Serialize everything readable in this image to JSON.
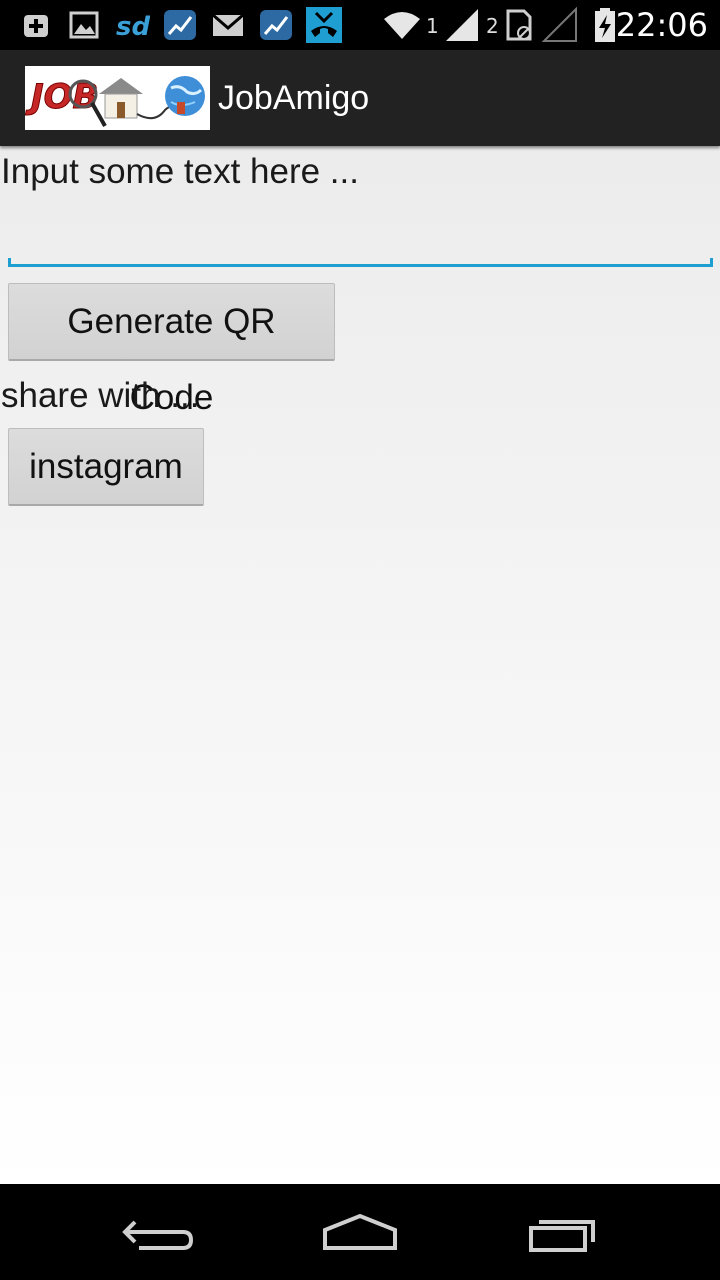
{
  "status_bar": {
    "time": "22:06",
    "sim1": "1",
    "sim2": "2",
    "icons": [
      "add-notification-icon",
      "gallery-icon",
      "sd-card-icon",
      "stocks-icon",
      "mail-icon",
      "stocks-icon",
      "missed-call-icon",
      "wifi-icon",
      "signal-icon",
      "no-sim-icon",
      "battery-charging-icon"
    ]
  },
  "app": {
    "title": "JobAmigo",
    "logo_text": "JOB"
  },
  "main": {
    "input_label": "Input some text here ...",
    "input_value": "",
    "input_placeholder": "",
    "generate_button": "Generate QR Code",
    "share_label": "share with ...",
    "instagram_button": "instagram"
  },
  "nav": {
    "icons": [
      "back-icon",
      "home-icon",
      "recent-apps-icon"
    ]
  },
  "colors": {
    "accent": "#1f9fd1",
    "action_bar": "#222222",
    "background": "#f0f0f0"
  }
}
